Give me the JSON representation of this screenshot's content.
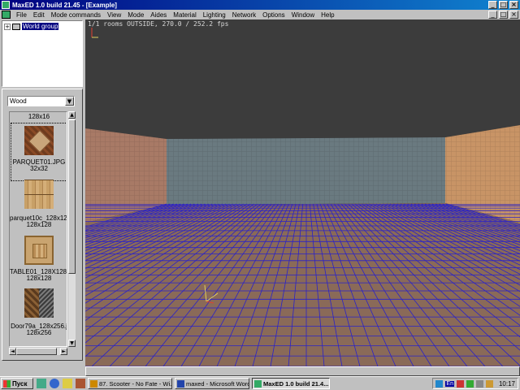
{
  "window": {
    "title": "MaxED 1.0 build 21.45 - [Example]",
    "minimize_glyph": "_",
    "maximize_glyph": "□",
    "close_glyph": "×"
  },
  "menu": {
    "items": [
      "File",
      "Edit",
      "Mode commands",
      "View",
      "Mode",
      "Aides",
      "Material",
      "Lighting",
      "Network",
      "Options",
      "Window",
      "Help"
    ]
  },
  "tree": {
    "expander": "+",
    "root_label": "World group"
  },
  "material": {
    "selected": "Wood",
    "dropdown_glyph": "▼",
    "textures": [
      {
        "name": "",
        "size": "128x16"
      },
      {
        "name": "PARQUET01.JPG",
        "size": "32x32"
      },
      {
        "name": "parquet10c_128x128.",
        "size": "128x128"
      },
      {
        "name": "TABLE01_128X128.",
        "size": "128x128"
      },
      {
        "name": "Door79a_128x256.j",
        "size": "128x256"
      }
    ]
  },
  "scroll": {
    "up": "▲",
    "down": "▼",
    "left": "◄",
    "right": "►"
  },
  "viewport": {
    "hud": "1/1 rooms OUTSIDE, 270.0 / 252.2 fps",
    "colors": {
      "ceiling": "#3c3c3c",
      "back_wall": "#6a7a80",
      "left_wall": "#a87a66",
      "right_wall": "#c89466",
      "floor": "#8a6a58",
      "grid": "#2a22c8"
    }
  },
  "taskbar": {
    "start_label": "Пуск",
    "tasks": [
      {
        "label": "87. Scooter - No Fate - Wi...",
        "active": false
      },
      {
        "label": "maxed - Microsoft Word",
        "active": false
      },
      {
        "label": "MaxED 1.0 build 21.4...",
        "active": true
      }
    ],
    "tray_lang": "En",
    "clock": "10:17"
  }
}
